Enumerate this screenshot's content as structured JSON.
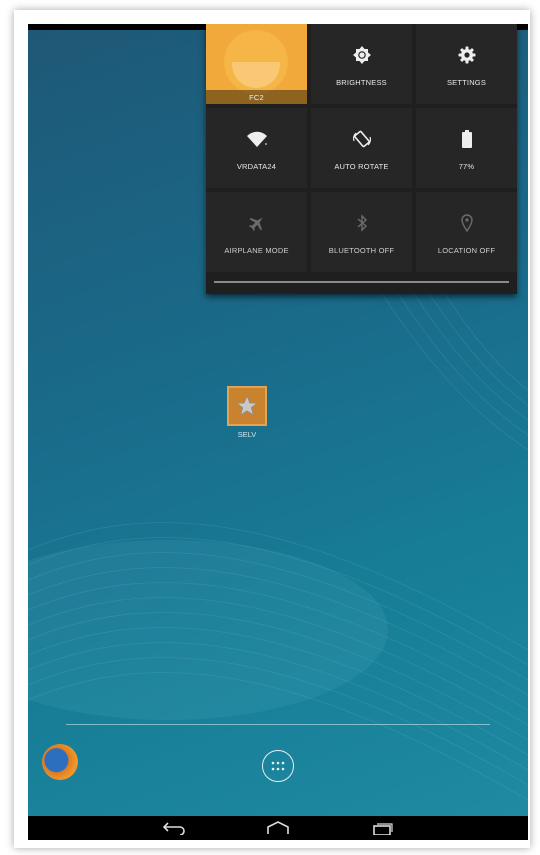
{
  "quick_settings": {
    "tiles": [
      {
        "label": "FC2",
        "icon": "user-avatar-icon"
      },
      {
        "label": "BRIGHTNESS",
        "icon": "brightness-icon"
      },
      {
        "label": "SETTINGS",
        "icon": "settings-gear-icon"
      },
      {
        "label": "VRDATA24",
        "icon": "wifi-icon"
      },
      {
        "label": "AUTO ROTATE",
        "icon": "auto-rotate-icon"
      },
      {
        "label": "77%",
        "icon": "battery-icon"
      },
      {
        "label": "AIRPLANE MODE",
        "icon": "airplane-icon"
      },
      {
        "label": "BLUETOOTH OFF",
        "icon": "bluetooth-icon"
      },
      {
        "label": "LOCATION OFF",
        "icon": "location-pin-icon"
      }
    ]
  },
  "desktop": {
    "shortcut_label": "SELV"
  },
  "colors": {
    "user_tile": "#f2a93b",
    "panel": "#1f1f1f",
    "tile": "#262626",
    "wallpaper": "#1a6a8a"
  }
}
